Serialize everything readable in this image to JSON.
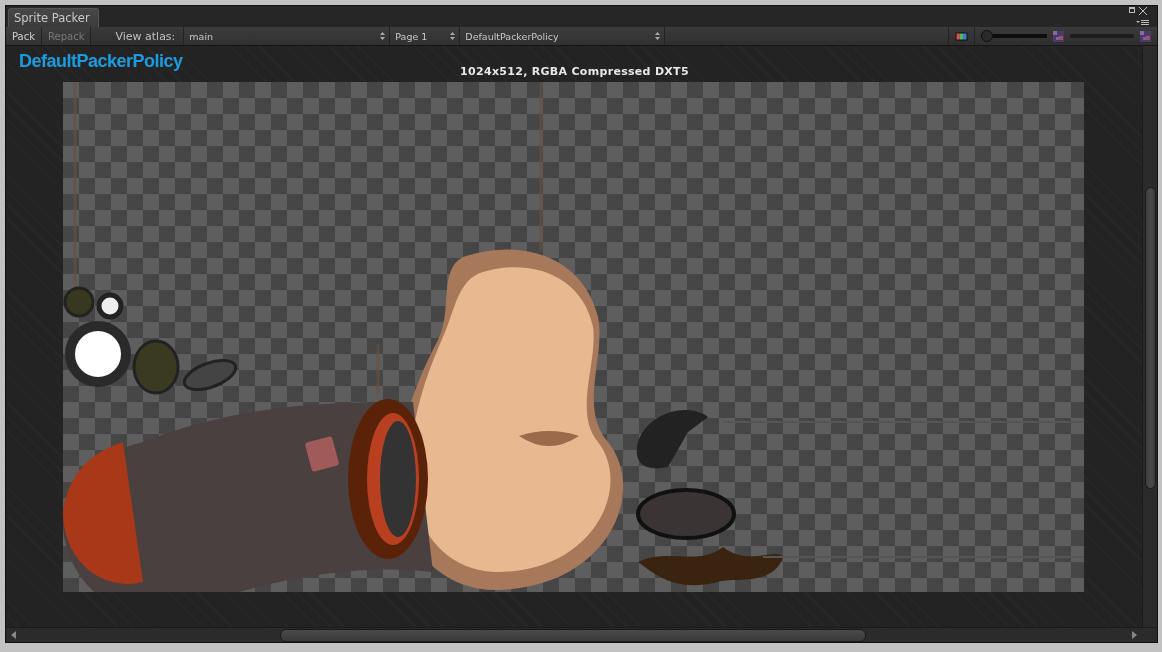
{
  "window": {
    "tab": "Sprite Packer"
  },
  "toolbar": {
    "buttons": [
      {
        "label": "Pack",
        "disabled": false
      },
      {
        "label": "Repack",
        "disabled": true
      }
    ],
    "view_atlas_label": "View atlas:",
    "dropdowns": [
      {
        "value": "main"
      },
      {
        "value": "Page 1"
      },
      {
        "value": "DefaultPackerPolicy"
      }
    ],
    "mip_slider": {
      "level": 0
    }
  },
  "policy_title": "DefaultPackerPolicy",
  "atlas_info": "1024x512, RGBA Compressed DXT5"
}
